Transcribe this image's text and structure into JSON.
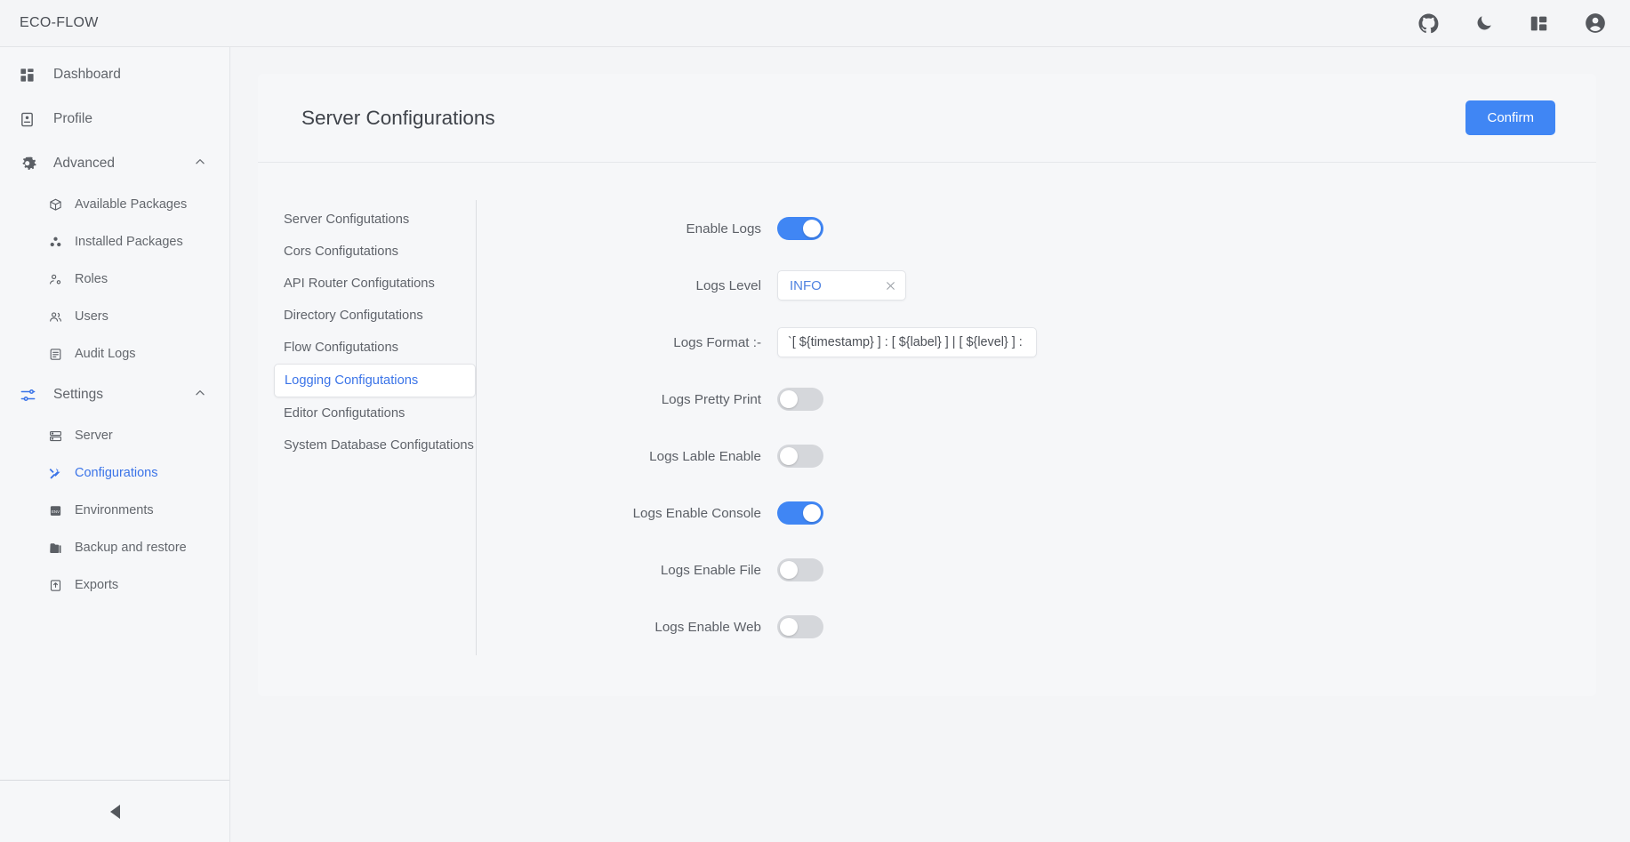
{
  "app": {
    "brand": "ECO-FLOW",
    "accent": "#4086f4",
    "link": "#3b74e8",
    "bg": "#f4f5f7"
  },
  "topbar": {
    "icons": [
      {
        "name": "github-icon",
        "title": "GitHub"
      },
      {
        "name": "moon-icon",
        "title": "Dark mode"
      },
      {
        "name": "layout-icon",
        "title": "Layout"
      },
      {
        "name": "account-icon",
        "title": "Account"
      }
    ]
  },
  "sidebar": {
    "items": [
      {
        "label": "Dashboard",
        "icon": "dashboard-grid-icon",
        "type": "item"
      },
      {
        "label": "Profile",
        "icon": "profile-card-icon",
        "type": "item"
      },
      {
        "label": "Advanced",
        "icon": "advanced-gears-icon",
        "type": "group",
        "expanded": true,
        "chevron": "chevron-up-icon"
      },
      {
        "label": "Available Packages",
        "icon": "package-search-icon",
        "type": "sub"
      },
      {
        "label": "Installed Packages",
        "icon": "packages-icon",
        "type": "sub"
      },
      {
        "label": "Roles",
        "icon": "role-user-icon",
        "type": "sub"
      },
      {
        "label": "Users",
        "icon": "users-icon",
        "type": "sub"
      },
      {
        "label": "Audit Logs",
        "icon": "audit-log-icon",
        "type": "sub"
      },
      {
        "label": "Settings",
        "icon": "sliders-icon",
        "type": "group",
        "expanded": true,
        "chevron": "chevron-up-icon"
      },
      {
        "label": "Server",
        "icon": "server-icon",
        "type": "sub"
      },
      {
        "label": "Configurations",
        "icon": "tools-icon",
        "type": "sub",
        "active": true
      },
      {
        "label": "Environments",
        "icon": "env-file-icon",
        "type": "sub"
      },
      {
        "label": "Backup and restore",
        "icon": "backup-icon",
        "type": "sub"
      },
      {
        "label": "Exports",
        "icon": "export-icon",
        "type": "sub"
      }
    ],
    "collapse_icon": "collapse-left-triangle-icon"
  },
  "page": {
    "title": "Server Configurations",
    "confirm_label": "Confirm"
  },
  "tabs": [
    {
      "label": "Server Configutations",
      "active": false
    },
    {
      "label": "Cors Configutations",
      "active": false
    },
    {
      "label": "API Router Configutations",
      "active": false
    },
    {
      "label": "Directory Configutations",
      "active": false
    },
    {
      "label": "Flow Configutations",
      "active": false
    },
    {
      "label": "Logging Configutations",
      "active": true
    },
    {
      "label": "Editor Configutations",
      "active": false
    },
    {
      "label": "System Database Configutations",
      "active": false
    }
  ],
  "form": {
    "enable_logs": {
      "label": "Enable Logs",
      "value": true
    },
    "logs_level": {
      "label": "Logs Level",
      "value": "INFO",
      "clear_icon": "close-x-icon"
    },
    "logs_format": {
      "label": "Logs Format :-",
      "value": "`[ ${timestamp} ] : [ ${label} ] | [ ${level} ] : ${m",
      "placeholder": "Logs Format"
    },
    "logs_pretty_print": {
      "label": "Logs Pretty Print",
      "value": false
    },
    "logs_lable_enable": {
      "label": "Logs Lable Enable",
      "value": false
    },
    "logs_enable_console": {
      "label": "Logs Enable Console",
      "value": true
    },
    "logs_enable_file": {
      "label": "Logs Enable File",
      "value": false
    },
    "logs_enable_web": {
      "label": "Logs Enable Web",
      "value": false
    }
  }
}
